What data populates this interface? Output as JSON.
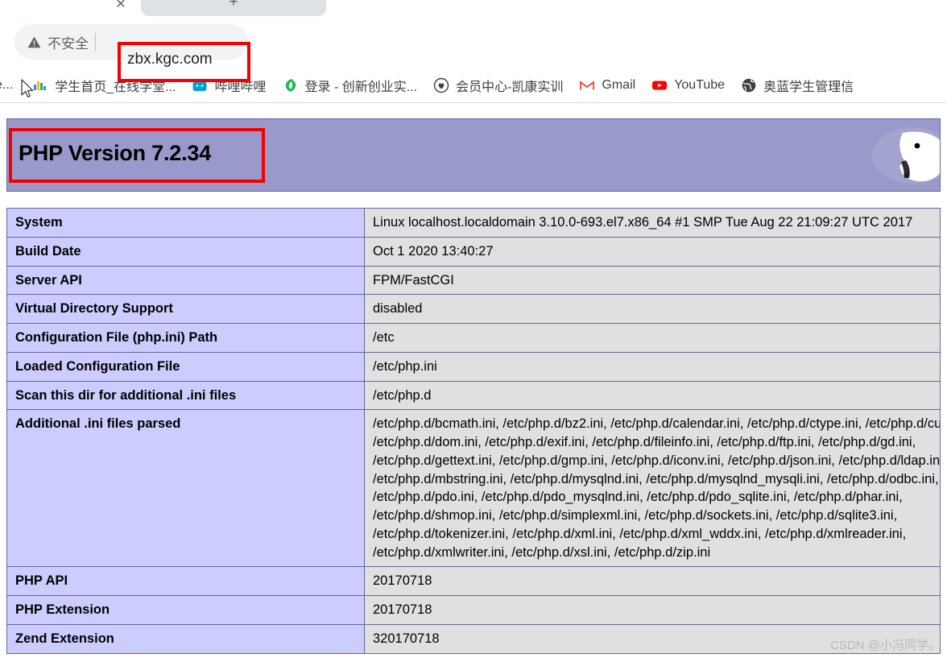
{
  "browser": {
    "tab_close_icon": "✕",
    "new_tab_icon": "+",
    "omnibox": {
      "security_icon": "warning-triangle-icon",
      "security_label": "不安全",
      "url": "zbx.kgc.com",
      "highlight_color": "#f40000"
    },
    "bookmarks": [
      {
        "label": "ve...",
        "icon": "drive-icon",
        "truncated": true
      },
      {
        "label": "学生首页_在线学堂...",
        "icon": "chart-bars-icon"
      },
      {
        "label": "哔哩哔哩",
        "icon": "bilibili-tv-icon"
      },
      {
        "label": "登录 - 创新创业实...",
        "icon": "green-swirl-icon"
      },
      {
        "label": "会员中心-凯康实训",
        "icon": "heart-circle-icon"
      },
      {
        "label": "Gmail",
        "icon": "gmail-m-icon"
      },
      {
        "label": "YouTube",
        "icon": "youtube-play-icon"
      },
      {
        "label": "奥蓝学生管理信",
        "icon": "globe-icon"
      }
    ]
  },
  "phpinfo": {
    "version_title": "PHP Version 7.2.34",
    "logo_alt": "php-elephant-logo",
    "header_bg": "#9999cc",
    "key_bg": "#ccccff",
    "value_bg": "#e0e0e0",
    "border_color": "#666699",
    "rows": [
      {
        "key": "System",
        "value": "Linux localhost.localdomain 3.10.0-693.el7.x86_64 #1 SMP Tue Aug 22 21:09:27 UTC 2017"
      },
      {
        "key": "Build Date",
        "value": "Oct 1 2020 13:40:27"
      },
      {
        "key": "Server API",
        "value": "FPM/FastCGI"
      },
      {
        "key": "Virtual Directory Support",
        "value": "disabled"
      },
      {
        "key": "Configuration File (php.ini) Path",
        "value": "/etc"
      },
      {
        "key": "Loaded Configuration File",
        "value": "/etc/php.ini"
      },
      {
        "key": "Scan this dir for additional .ini files",
        "value": "/etc/php.d"
      },
      {
        "key": "Additional .ini files parsed",
        "value": "/etc/php.d/bcmath.ini, /etc/php.d/bz2.ini, /etc/php.d/calendar.ini, /etc/php.d/ctype.ini, /etc/php.d/curl.ini,\n/etc/php.d/dom.ini, /etc/php.d/exif.ini, /etc/php.d/fileinfo.ini, /etc/php.d/ftp.ini, /etc/php.d/gd.ini,\n/etc/php.d/gettext.ini, /etc/php.d/gmp.ini, /etc/php.d/iconv.ini, /etc/php.d/json.ini, /etc/php.d/ldap.ini,\n/etc/php.d/mbstring.ini, /etc/php.d/mysqlnd.ini, /etc/php.d/mysqlnd_mysqli.ini, /etc/php.d/odbc.ini,\n/etc/php.d/pdo.ini, /etc/php.d/pdo_mysqlnd.ini, /etc/php.d/pdo_sqlite.ini, /etc/php.d/phar.ini,\n/etc/php.d/shmop.ini, /etc/php.d/simplexml.ini, /etc/php.d/sockets.ini, /etc/php.d/sqlite3.ini,\n/etc/php.d/tokenizer.ini, /etc/php.d/xml.ini, /etc/php.d/xml_wddx.ini, /etc/php.d/xmlreader.ini,\n/etc/php.d/xmlwriter.ini, /etc/php.d/xsl.ini, /etc/php.d/zip.ini"
      },
      {
        "key": "PHP API",
        "value": "20170718"
      },
      {
        "key": "PHP Extension",
        "value": "20170718"
      },
      {
        "key": "Zend Extension",
        "value": "320170718"
      }
    ]
  },
  "watermark": {
    "text": "CSDN @小冯同学。"
  }
}
